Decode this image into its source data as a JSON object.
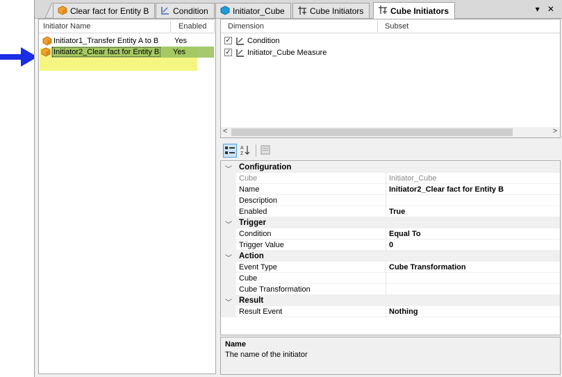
{
  "tabs": [
    {
      "label": "Clear fact for Entity B",
      "icon": "cube-icon"
    },
    {
      "label": "Condition",
      "icon": "dimension-icon"
    },
    {
      "label": "Initiator_Cube",
      "icon": "sphere-cube-icon"
    },
    {
      "label": "Cube Initiators",
      "icon": "initiator-icon"
    },
    {
      "label": "Cube Initiators",
      "icon": "initiator-icon",
      "active": true
    }
  ],
  "tab_controls": "▾ ✕",
  "initiators": {
    "col_name": "Initiator Name",
    "col_enabled": "Enabled",
    "rows": [
      {
        "name": "Initiator1_Transfer Entity A to B",
        "enabled": "Yes",
        "selected": false
      },
      {
        "name": "Initiator2_Clear fact for Entity B",
        "enabled": "Yes",
        "selected": true
      }
    ]
  },
  "dimensions": {
    "col_dimension": "Dimension",
    "col_subset": "Subset",
    "rows": [
      {
        "label": "Condition",
        "checked": true
      },
      {
        "label": "Initiator_Cube Measure",
        "checked": true
      }
    ],
    "scroll_left": "<",
    "scroll_right": ">"
  },
  "properties": {
    "categories": [
      {
        "title": "Configuration",
        "items": [
          {
            "name": "Cube",
            "value": "Initiator_Cube",
            "disabled": true
          },
          {
            "name": "Name",
            "value": "Initiator2_Clear fact for Entity B",
            "bold": true
          },
          {
            "name": "Description",
            "value": ""
          },
          {
            "name": "Enabled",
            "value": "True",
            "bold": true
          }
        ]
      },
      {
        "title": "Trigger",
        "items": [
          {
            "name": "Condition",
            "value": "Equal To",
            "bold": true
          },
          {
            "name": "Trigger Value",
            "value": "0",
            "bold": true
          }
        ]
      },
      {
        "title": "Action",
        "items": [
          {
            "name": "Event Type",
            "value": "Cube Transformation",
            "bold": true
          },
          {
            "name": "Cube",
            "value": ""
          },
          {
            "name": "Cube Transformation",
            "value": ""
          }
        ]
      },
      {
        "title": "Result",
        "items": [
          {
            "name": "Result Event",
            "value": "Nothing",
            "bold": true
          }
        ]
      }
    ]
  },
  "description": {
    "title": "Name",
    "text": "The name of the initiator"
  },
  "colors": {
    "arrow": "#1a2ee6",
    "highlight": "#f3f56b",
    "selection": "#9cc35e",
    "cube_icon": "#f0a030"
  }
}
